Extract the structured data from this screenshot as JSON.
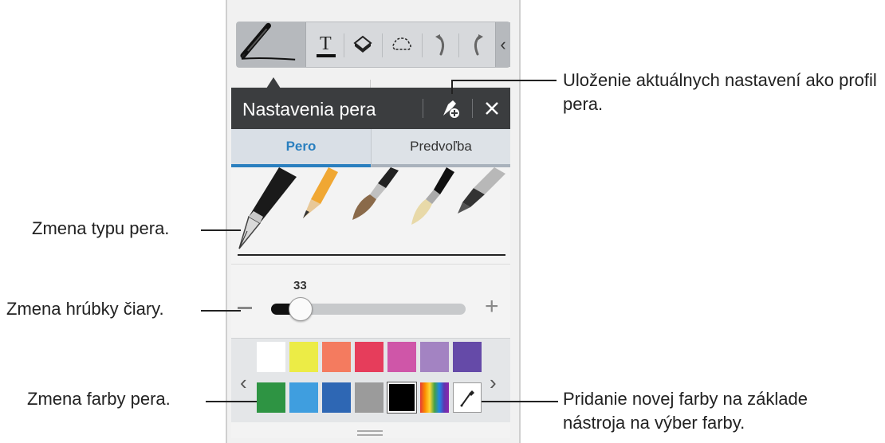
{
  "toolbar": {
    "tools": [
      "pen-icon",
      "text-icon",
      "eraser-icon",
      "selection-icon",
      "undo-icon",
      "redo-icon"
    ],
    "collapse_icon": "chevron-left-icon"
  },
  "panel": {
    "title": "Nastavenia pera",
    "save_profile_icon": "pen-add-icon",
    "close_icon": "close-icon",
    "tabs": [
      {
        "label": "Pero",
        "active": true
      },
      {
        "label": "Predvoľba",
        "active": false
      }
    ],
    "pen_types": [
      "fountain-pen",
      "pencil",
      "brush",
      "calligraphy-brush",
      "marker"
    ],
    "thickness": {
      "value": "33",
      "fraction": 0.15
    },
    "colors_row1": [
      "#ffffff",
      "#ecec46",
      "#f47b5f",
      "#e63d5b",
      "#cf56a8",
      "#a383c2",
      "#654aa8"
    ],
    "colors_row2": [
      "#2e9443",
      "#3f9edf",
      "#2e67b4",
      "#9b9b9b",
      "#000000",
      "rainbow",
      "eyedropper"
    ],
    "arrow_left": "‹",
    "arrow_right": "›"
  },
  "callouts": {
    "save_profile": "Uloženie aktuálnych nastavení ako profil pera.",
    "pen_type": "Zmena typu pera.",
    "line_thickness": "Zmena hrúbky čiary.",
    "pen_color": "Zmena farby pera.",
    "add_color": "Pridanie novej farby na základe nástroja na výber farby."
  }
}
